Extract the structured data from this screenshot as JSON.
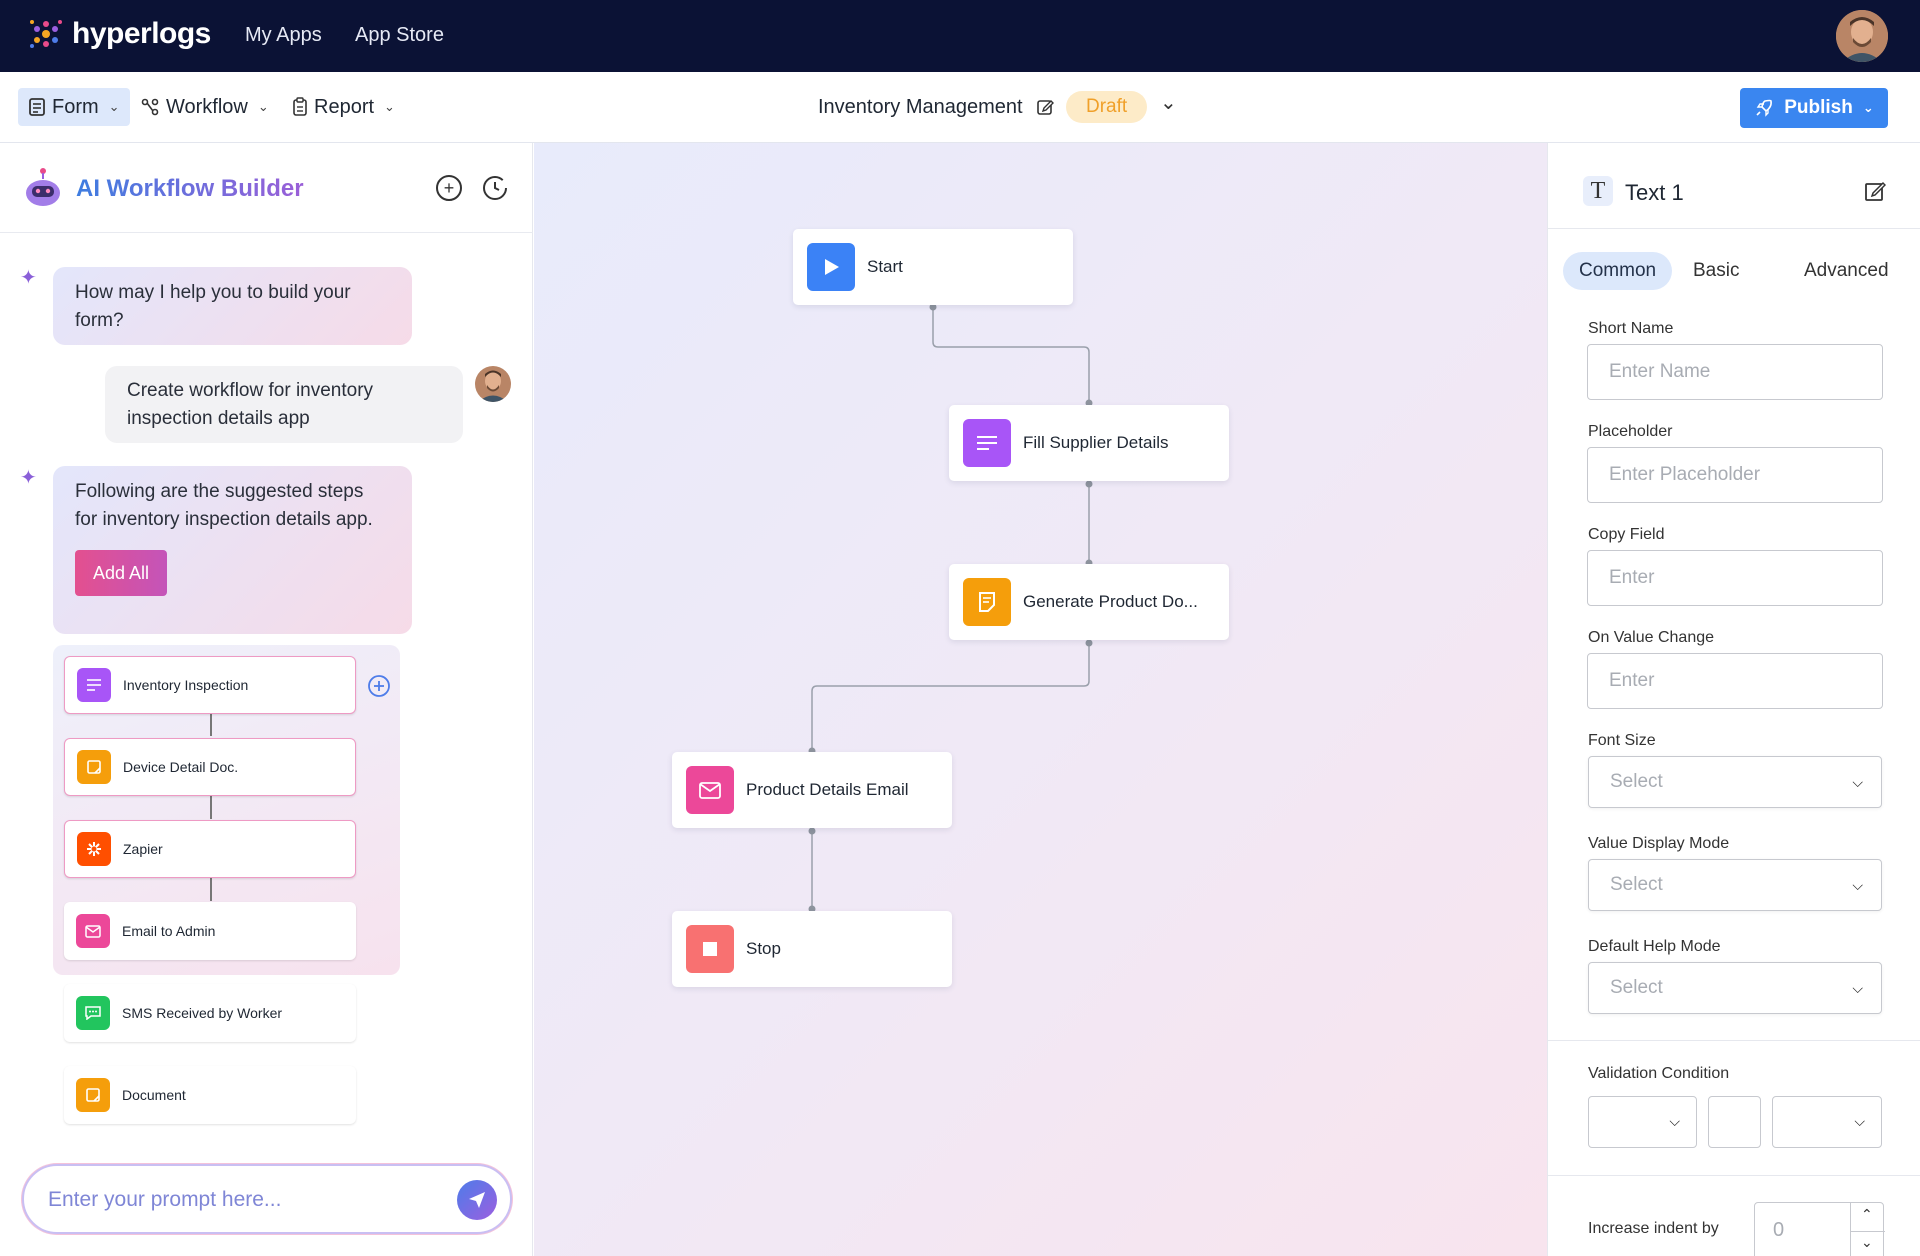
{
  "topbar": {
    "brand": "hyperlogs",
    "nav": [
      "My Apps",
      "App Store"
    ]
  },
  "toolbar": {
    "menus": [
      {
        "label": "Form",
        "icon": "form-icon"
      },
      {
        "label": "Workflow",
        "icon": "workflow-icon"
      },
      {
        "label": "Report",
        "icon": "report-icon"
      }
    ],
    "doc_title": "Inventory Management",
    "status": "Draft",
    "publish_label": "Publish"
  },
  "left": {
    "title": "AI Workflow Builder",
    "messages": {
      "ai1": "How may I help you to build your form?",
      "user1": "Create workflow for inventory inspection details app",
      "ai2": "Following are the suggested steps for inventory inspection details app.",
      "add_all": "Add All"
    },
    "steps": [
      {
        "label": "Inventory Inspection",
        "icon": "form-lines-icon",
        "color": "#a855f7"
      },
      {
        "label": "Device Detail Doc.",
        "icon": "document-icon",
        "color": "#f59e0b"
      },
      {
        "label": "Zapier",
        "icon": "zapier-icon",
        "color": "#ff4f00"
      },
      {
        "label": "Email to Admin",
        "icon": "mail-icon",
        "color": "#ec4899"
      },
      {
        "label": "SMS Received by Worker",
        "icon": "sms-icon",
        "color": "#22c55e"
      },
      {
        "label": "Document",
        "icon": "document-icon",
        "color": "#f59e0b"
      }
    ],
    "prompt_placeholder": "Enter your prompt here..."
  },
  "canvas": {
    "nodes": [
      {
        "label": "Start",
        "icon": "play-icon",
        "color": "#3b82f6"
      },
      {
        "label": "Fill Supplier Details",
        "icon": "form-lines-icon",
        "color": "#a855f7"
      },
      {
        "label": "Generate Product Do...",
        "icon": "document-icon",
        "color": "#f59e0b"
      },
      {
        "label": "Product Details Email",
        "icon": "mail-icon",
        "color": "#ec4899"
      },
      {
        "label": "Stop",
        "icon": "stop-icon",
        "color": "#f87171"
      }
    ]
  },
  "right": {
    "title": "Text 1",
    "tabs": [
      "Common",
      "Basic",
      "Advanced"
    ],
    "fields": {
      "short_name": {
        "label": "Short Name",
        "placeholder": "Enter Name"
      },
      "placeholder": {
        "label": "Placeholder",
        "placeholder": "Enter Placeholder"
      },
      "copy_field": {
        "label": "Copy Field",
        "placeholder": "Enter"
      },
      "on_value_change": {
        "label": "On Value Change",
        "placeholder": "Enter"
      },
      "font_size": {
        "label": "Font Size",
        "value": "Select"
      },
      "value_display_mode": {
        "label": "Value Display Mode",
        "value": "Select"
      },
      "default_help_mode": {
        "label": "Default Help Mode",
        "value": "Select"
      },
      "validation_condition": {
        "label": "Validation Condition"
      },
      "increase_indent": {
        "label": "Increase indent by",
        "value": "0"
      }
    }
  }
}
